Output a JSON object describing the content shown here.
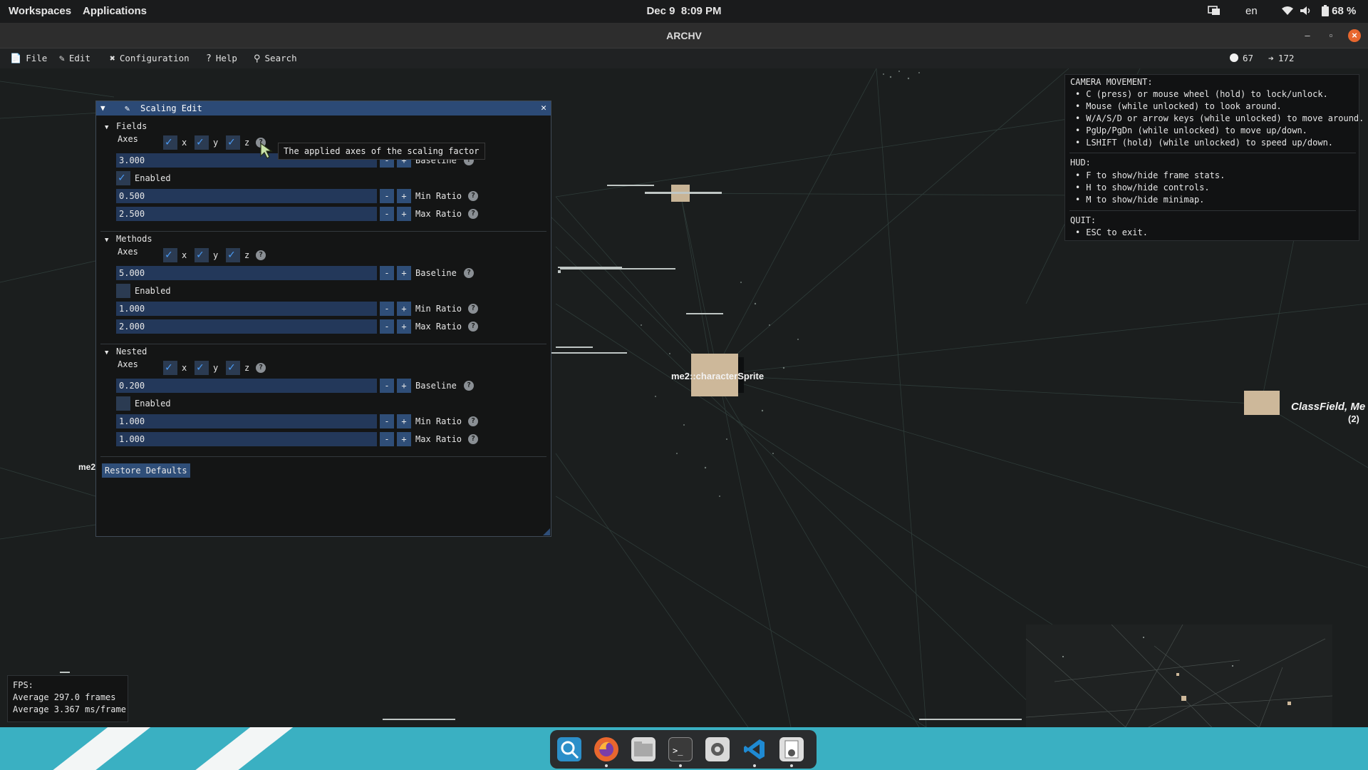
{
  "topbar": {
    "workspaces": "Workspaces",
    "applications": "Applications",
    "date": "Dec 9",
    "time": "8:09 PM",
    "language": "en",
    "battery": "68 %"
  },
  "window": {
    "title": "ARCHV"
  },
  "menu": {
    "file": "File",
    "edit": "Edit",
    "configuration": "Configuration",
    "help": "Help",
    "search": "Search",
    "vertices_count": "67",
    "edges_count": "172"
  },
  "panel": {
    "title": "Scaling Edit",
    "tooltip": "The applied axes of the scaling factor",
    "restore_label": "Restore Defaults",
    "labels": {
      "axes": "Axes",
      "x": "x",
      "y": "y",
      "z": "z",
      "enabled": "Enabled",
      "baseline": "Baseline",
      "min_ratio": "Min Ratio",
      "max_ratio": "Max Ratio",
      "minus": "-",
      "plus": "+"
    },
    "sections": {
      "fields": {
        "name": "Fields",
        "axes": {
          "x": true,
          "y": true,
          "z": true
        },
        "baseline": "3.000",
        "enabled": true,
        "min_ratio": "0.500",
        "max_ratio": "2.500"
      },
      "methods": {
        "name": "Methods",
        "axes": {
          "x": true,
          "y": true,
          "z": true
        },
        "baseline": "5.000",
        "enabled": false,
        "min_ratio": "1.000",
        "max_ratio": "2.000"
      },
      "nested": {
        "name": "Nested",
        "axes": {
          "x": true,
          "y": true,
          "z": true
        },
        "baseline": "0.200",
        "enabled": false,
        "min_ratio": "1.000",
        "max_ratio": "1.000"
      }
    }
  },
  "help_overlay": {
    "camera_heading": "CAMERA MOVEMENT:",
    "camera_items": [
      "C (press) or mouse wheel (hold) to lock/unlock.",
      "Mouse (while unlocked) to look around.",
      "W/A/S/D or arrow keys (while unlocked) to move around.",
      "PgUp/PgDn (while unlocked) to move up/down.",
      "LSHIFT (hold) (while unlocked) to speed up/down."
    ],
    "hud_heading": "HUD:",
    "hud_items": [
      "F to show/hide frame stats.",
      "H to show/hide controls.",
      "M to show/hide minimap."
    ],
    "quit_heading": "QUIT:",
    "quit_items": [
      "ESC to exit."
    ]
  },
  "fps": {
    "heading": "FPS:",
    "frames": "Average 297.0 frames",
    "ms": "Average 3.367 ms/frame"
  },
  "graph": {
    "node_main": "me2::characterSprite",
    "node_right": "ClassField, Me",
    "node_right_count": "(2)",
    "node_left_partial": "me2"
  },
  "colors": {
    "accent": "#2c4a76",
    "field_bg": "#23385a",
    "check": "#4b9cf5",
    "dock": "#3ab0c2",
    "node": "#cdb89a"
  }
}
